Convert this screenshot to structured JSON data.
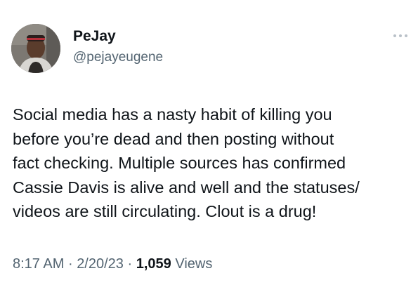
{
  "author": {
    "name": "PeJay",
    "handle": "@pejayeugene"
  },
  "tweet": {
    "text": "Social media has a nasty habit of killing you\nbefore you’re dead and then posting without\nfact checking. Multiple sources has confirmed\nCassie Davis is alive and well and the statuses/\nvideos are still circulating. Clout is a drug!"
  },
  "meta": {
    "time": "8:17 AM",
    "separator": "·",
    "date": "2/20/23",
    "views_count": "1,059",
    "views_label": "Views"
  },
  "icons": {
    "more": "more-options-icon",
    "avatar": "profile-photo"
  },
  "colors": {
    "text_primary": "#0f1419",
    "text_secondary": "#536471"
  }
}
